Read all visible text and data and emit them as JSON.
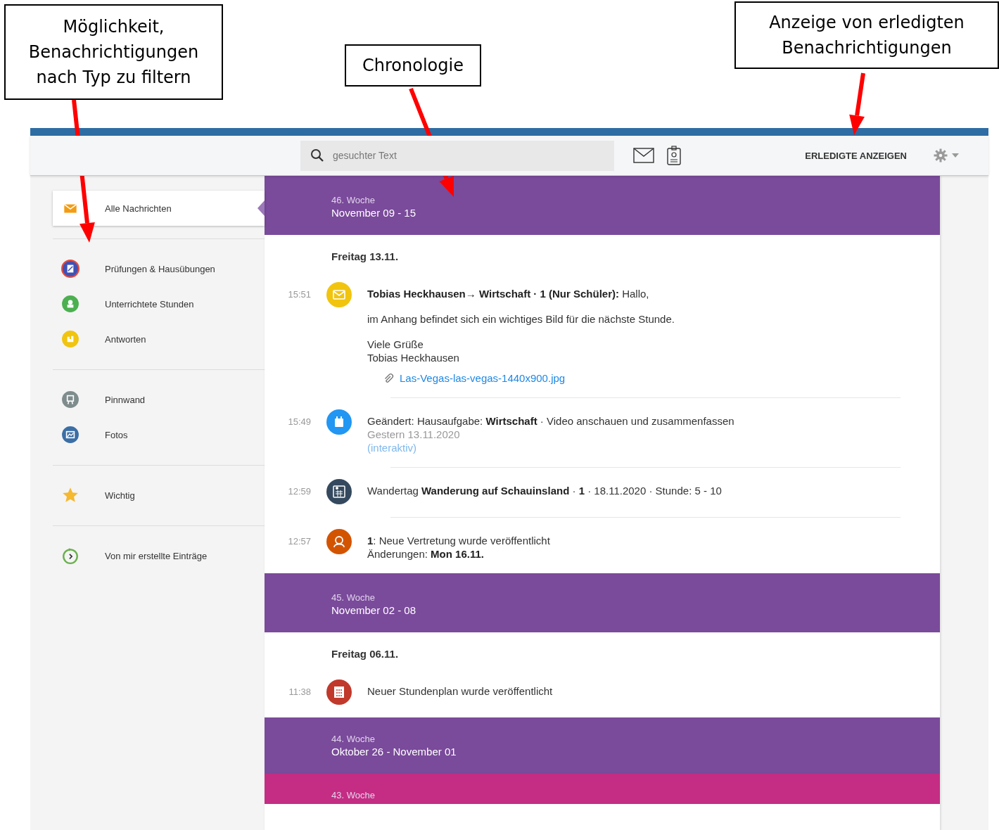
{
  "callouts": [
    {
      "text": "Möglichkeit, Benachrichtigungen nach Typ zu filtern",
      "kind": "filter"
    },
    {
      "text": "Chronologie",
      "kind": "timeline"
    },
    {
      "text": "Anzeige von erledigten Benachrichtigungen",
      "kind": "done"
    }
  ],
  "toolbar": {
    "search": {
      "placeholder": "gesuchter Text"
    },
    "done_button": "ERLEDIGTE ANZEIGEN"
  },
  "sidebar": {
    "groups": [
      [
        {
          "label": "Alle Nachrichten",
          "kind": "mail",
          "selected": true
        }
      ],
      [
        {
          "label": "Prüfungen & Hausübungen",
          "kind": "exam",
          "selected": false
        },
        {
          "label": "Unterrichtete Stunden",
          "kind": "lesson",
          "selected": false
        },
        {
          "label": "Antworten",
          "kind": "answer",
          "selected": false
        }
      ],
      [
        {
          "label": "Pinnwand",
          "kind": "board",
          "selected": false
        },
        {
          "label": "Fotos",
          "kind": "photo",
          "selected": false
        }
      ],
      [
        {
          "label": "Wichtig",
          "kind": "star",
          "selected": false
        }
      ],
      [
        {
          "label": "Von mir erstellte Einträge",
          "kind": "created",
          "selected": false
        }
      ]
    ]
  },
  "weeks": [
    {
      "week": "46. Woche",
      "range": "November 09 - 15",
      "color": "#7a4a9b",
      "days": [
        {
          "title": "Freitag 13.11.",
          "entries": [
            {
              "time": "15:51",
              "kind": "mail",
              "blocks": [
                {
                  "kind": "para",
                  "lines": [
                    "**Tobias Heckhausen→ Wirtschaft · 1 (Nur Schüler):** Hallo,"
                  ]
                },
                {
                  "kind": "para",
                  "lines": [
                    "im Anhang befindet sich ein wichtiges Bild für die nächste Stunde."
                  ]
                },
                {
                  "kind": "para",
                  "lines": [
                    "Viele Grüße",
                    "Tobias Heckhausen"
                  ]
                },
                {
                  "kind": "attachment",
                  "lines": [
                    "Las-Vegas-las-vegas-1440x900.jpg"
                  ]
                }
              ]
            },
            {
              "time": "15:49",
              "kind": "homework",
              "blocks": [
                {
                  "kind": "para",
                  "lines": [
                    "Geändert: Hausaufgabe: **Wirtschaft** · Video anschauen und zusammenfassen"
                  ]
                },
                {
                  "kind": "muted",
                  "lines": [
                    "Gestern 13.11.2020"
                  ]
                },
                {
                  "kind": "link",
                  "lines": [
                    "(interaktiv)"
                  ]
                }
              ]
            },
            {
              "time": "12:59",
              "kind": "trip",
              "blocks": [
                {
                  "kind": "para",
                  "lines": [
                    "Wandertag **Wanderung auf Schauinsland** · **1** · 18.11.2020 · Stunde: 5 - 10"
                  ]
                }
              ]
            },
            {
              "time": "12:57",
              "kind": "substitution",
              "blocks": [
                {
                  "kind": "para",
                  "lines": [
                    "**1**: Neue Vertretung wurde veröffentlicht",
                    "Änderungen: **Mon 16.11.**"
                  ]
                }
              ]
            }
          ]
        }
      ]
    },
    {
      "week": "45. Woche",
      "range": "November 02 - 08",
      "color": "#7a4a9b",
      "days": [
        {
          "title": "Freitag 06.11.",
          "entries": [
            {
              "time": "11:38",
              "kind": "timetable",
              "blocks": [
                {
                  "kind": "para",
                  "lines": [
                    "Neuer Stundenplan wurde veröffentlicht"
                  ]
                }
              ]
            }
          ]
        }
      ]
    },
    {
      "week": "44. Woche",
      "range": "Oktober 26 - November 01",
      "color": "#7a4a9b"
    },
    {
      "week": "43. Woche",
      "color": "#c42d83"
    }
  ]
}
